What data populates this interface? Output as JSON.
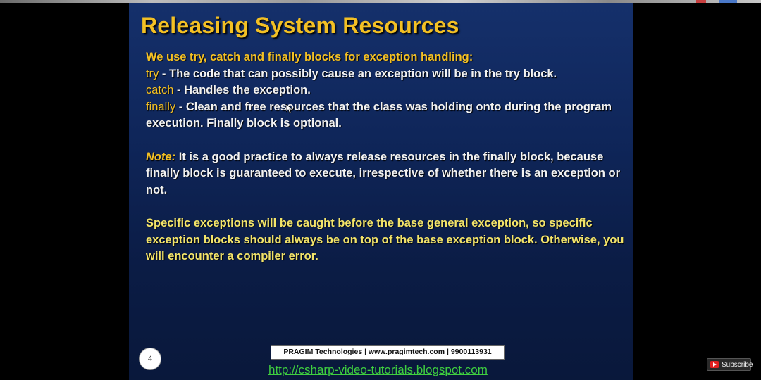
{
  "slide": {
    "title": "Releasing System Resources",
    "intro": "We use try, catch and finally blocks for exception handling:",
    "items": [
      {
        "keyword": "try",
        "text": " - The code that can possibly cause an exception will be in the try block."
      },
      {
        "keyword": "catch",
        "text": " - Handles the exception."
      },
      {
        "keyword": "finally",
        "text": " - Clean and free resources that the class was holding onto during the program execution. Finally block is optional."
      }
    ],
    "note_label": "Note:",
    "note_text": " It is a good practice to always release resources in the finally block, because finally block is guaranteed to execute, irrespective of whether there is an exception or not.",
    "specific_text": "Specific exceptions will be caught before the base general exception, so specific exception blocks should always be on top of the base exception block. Otherwise, you will encounter a compiler error.",
    "page_number": "4",
    "footer_company": "PRAGIM Technologies | www.pragimtech.com | 9900113931",
    "footer_link": "http://csharp-video-tutorials.blogspot.com"
  },
  "overlay": {
    "subscribe_label": "Subscribe"
  },
  "colors": {
    "title": "#f3c024",
    "keyword": "#f3c024",
    "body": "#f2f2f2",
    "link": "#3fcf3f",
    "slide_bg": "#0f265a"
  }
}
